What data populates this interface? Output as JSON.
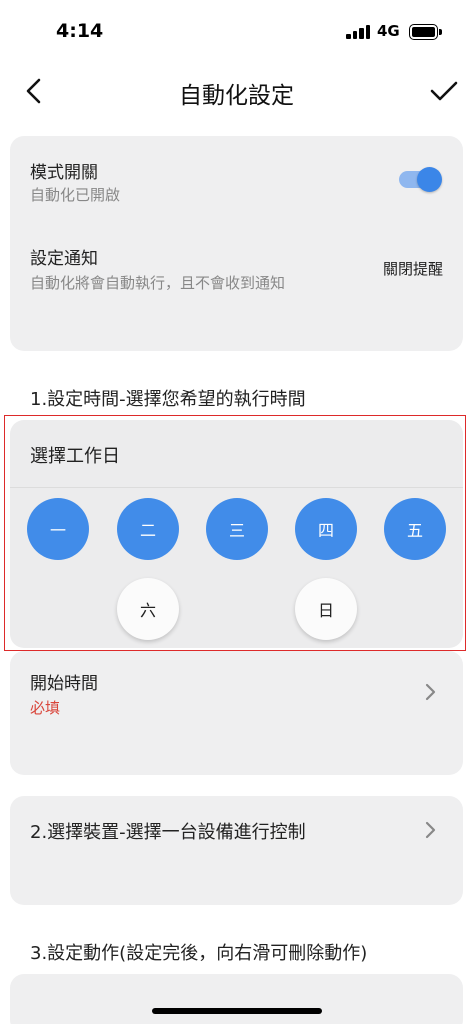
{
  "status_bar": {
    "time": "4:14",
    "network": "4G"
  },
  "nav": {
    "title": "自動化設定"
  },
  "settings_card": {
    "mode_title": "模式開關",
    "mode_status": "自動化已開啟",
    "mode_enabled": true,
    "notify_title": "設定通知",
    "notify_desc": "自動化將會自動執行，且不會收到通知",
    "notify_value": "關閉提醒"
  },
  "section1": {
    "label": "1.設定時間-選擇您希望的執行時間"
  },
  "weekday_picker": {
    "header": "選擇工作日",
    "days": [
      {
        "label": "一",
        "selected": true
      },
      {
        "label": "二",
        "selected": true
      },
      {
        "label": "三",
        "selected": true
      },
      {
        "label": "四",
        "selected": true
      },
      {
        "label": "五",
        "selected": true
      },
      {
        "label": "六",
        "selected": false
      },
      {
        "label": "日",
        "selected": false
      }
    ]
  },
  "start_time": {
    "label": "開始時間",
    "required": "必填"
  },
  "section2": {
    "label": "2.選擇裝置-選擇一台設備進行控制"
  },
  "section3": {
    "label": "3.設定動作(設定完後，向右滑可刪除動作)"
  },
  "colors": {
    "accent": "#418ce9",
    "required": "#d9463b",
    "highlight": "#dd2a2a",
    "card": "#efeff0"
  }
}
